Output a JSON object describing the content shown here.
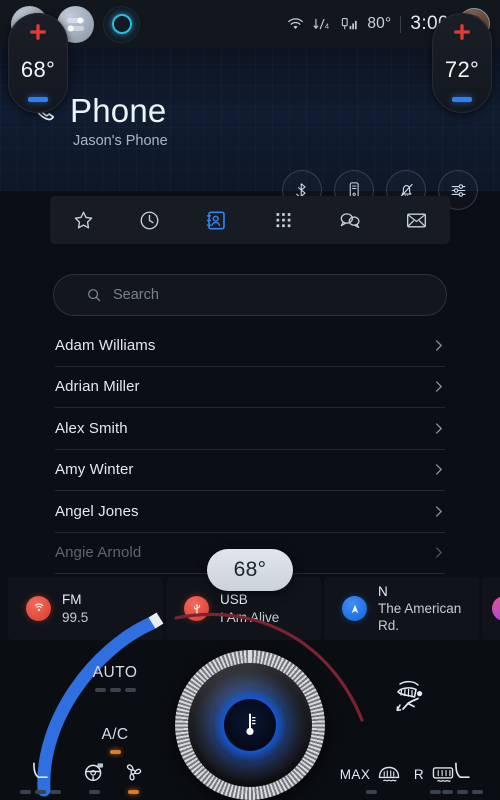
{
  "statusbar": {
    "launchers": [
      {
        "name": "home",
        "label": "Home"
      },
      {
        "name": "apps",
        "label": "Apps"
      },
      {
        "name": "voice-assistant",
        "label": "Voice Assistant"
      }
    ],
    "wifi_icon": "wifi-icon",
    "data_icon": "data-transfer-icon",
    "data_label": "4",
    "signal_icon": "cellular-signal-icon",
    "temperature": "80°",
    "clock": "3:00",
    "avatar_label": "User Profile"
  },
  "header": {
    "icon": "phone-handset-icon",
    "title": "Phone",
    "subtitle": "Jason's Phone",
    "actions": [
      {
        "name": "bluetooth-disconnect-icon",
        "label": "Disconnect"
      },
      {
        "name": "phone-transfer-icon",
        "label": "Transfer Call"
      },
      {
        "name": "notifications-off-icon",
        "label": "Mute Notifications"
      },
      {
        "name": "settings-sliders-icon",
        "label": "Phone Settings"
      }
    ]
  },
  "tabs": [
    {
      "name": "tab-favorites",
      "icon": "star-icon",
      "label": "Favorites",
      "active": false
    },
    {
      "name": "tab-recents",
      "icon": "clock-icon",
      "label": "Recents",
      "active": false
    },
    {
      "name": "tab-contacts",
      "icon": "contact-card-icon",
      "label": "Contacts",
      "active": true
    },
    {
      "name": "tab-dialpad",
      "icon": "dialpad-icon",
      "label": "Dialpad",
      "active": false
    },
    {
      "name": "tab-messages",
      "icon": "chat-bubbles-icon",
      "label": "Messages",
      "active": false
    },
    {
      "name": "tab-voicemail",
      "icon": "envelope-icon",
      "label": "Voicemail",
      "active": false
    }
  ],
  "search": {
    "icon": "search-icon",
    "placeholder": "Search",
    "value": ""
  },
  "contacts": [
    {
      "name": "Adam Williams",
      "dim": false
    },
    {
      "name": "Adrian Miller",
      "dim": false
    },
    {
      "name": "Alex Smith",
      "dim": false
    },
    {
      "name": "Amy Winter",
      "dim": false
    },
    {
      "name": "Angel Jones",
      "dim": false
    },
    {
      "name": "Angie Arnold",
      "dim": true
    }
  ],
  "tooltip": {
    "value": "68°"
  },
  "media_cards": [
    {
      "icon": "radio-icon",
      "icon_color": "#d83b2c",
      "line1": "FM",
      "line2": "99.5"
    },
    {
      "icon": "usb-icon",
      "icon_color": "#d83b2c",
      "line1": "USB",
      "line2": "I Am Alive"
    },
    {
      "icon": "navigation-icon",
      "icon_color": "#1562d8",
      "line1": "N",
      "line2": "The American Rd."
    },
    {
      "icon": "app-icon",
      "icon_color": "#f0508f",
      "line1": "",
      "line2": ""
    }
  ],
  "climate": {
    "left": {
      "plus": "+",
      "temp": "68°",
      "minus": "−"
    },
    "right": {
      "plus": "+",
      "temp": "72°",
      "minus": "−"
    },
    "auto_label": "AUTO",
    "auto_level": 0,
    "ac_label": "A/C",
    "ac_on": true,
    "knob_icon": "thermometer-icon",
    "seat_airflow_icon": "seat-airflow-icon",
    "accent_cold": "#2f7ff0",
    "accent_hot": "#e23b36",
    "accent_amber": "#e07b21"
  },
  "toolbar": [
    {
      "name": "heated-seat-left-icon",
      "label": "Heated Seat Left",
      "level": 0,
      "dashes": 3
    },
    {
      "name": "heated-steering-wheel-icon",
      "label": "Heated Steering Wheel",
      "level": 0,
      "dashes": 1
    },
    {
      "name": "fan-icon",
      "label": "Fan Speed",
      "level": 1,
      "dashes": 1
    },
    {
      "name": "max-defrost-icon",
      "label": "MAX",
      "level": 0,
      "dashes": 1
    },
    {
      "name": "rear-defrost-icon",
      "label": "R",
      "level": 0,
      "dashes": 1
    },
    {
      "name": "heated-seat-right-icon",
      "label": "Heated Seat Right",
      "level": 0,
      "dashes": 3
    }
  ]
}
